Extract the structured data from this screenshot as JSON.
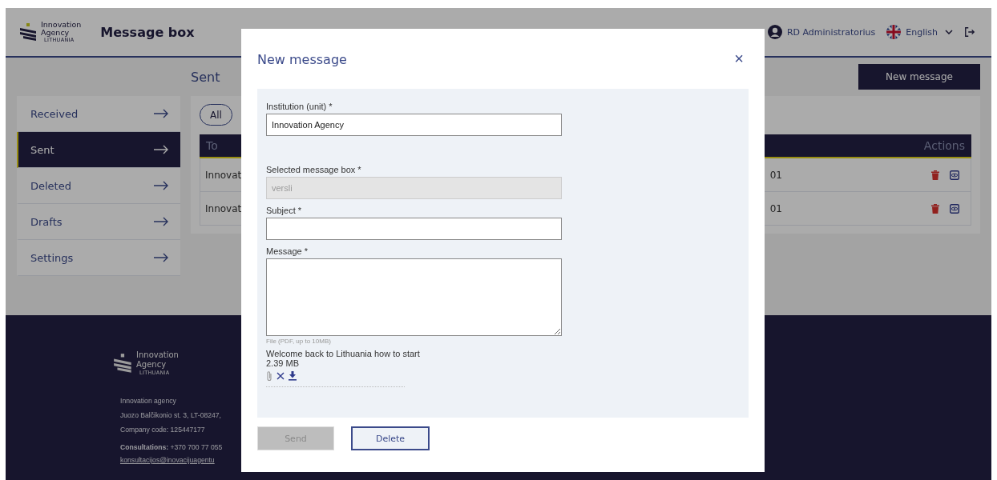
{
  "header": {
    "logo": {
      "line_1": "Innovation",
      "line_2": "Agency",
      "line_3": "LITHUANIA"
    },
    "title": "Message box",
    "user": "RD Administratorius",
    "language": "English"
  },
  "sidebar": {
    "items": [
      {
        "label": "Received",
        "selected": false
      },
      {
        "label": "Sent",
        "selected": true
      },
      {
        "label": "Deleted",
        "selected": false
      },
      {
        "label": "Drafts",
        "selected": false
      },
      {
        "label": "Settings",
        "selected": false
      }
    ]
  },
  "page_heading": "Sent",
  "new_message_button": "New message",
  "filters": [
    {
      "label": "All"
    }
  ],
  "table": {
    "columns": [
      "To",
      "Actions"
    ],
    "rows": [
      {
        "to": "Innovat",
        "column_2": "01"
      },
      {
        "to": "Innovat",
        "column_2": "01"
      }
    ]
  },
  "footer": {
    "logo": {
      "line_1": "Innovation",
      "line_2": "Agency",
      "line_3": "LITHUANIA"
    },
    "lines": [
      "Innovation agency",
      "Juozo Balčikonio st. 3, LT-08247,",
      "Company code: 125447177"
    ],
    "consultations_label": "Consultations:",
    "phone": "+370 700 77 055",
    "email": "konsultacijos@inovacijuagentu"
  },
  "modal": {
    "title": "New message",
    "close": "×",
    "fields": [
      {
        "kind": "input",
        "label": "Institution (unit) *",
        "value": "Innovation Agency",
        "disabled": false
      },
      {
        "kind": "input",
        "label": "Selected message box *",
        "value": "versli",
        "disabled": true
      },
      {
        "kind": "input",
        "label": "Subject *",
        "disabled": false
      },
      {
        "kind": "textarea",
        "label": "Message *",
        "disabled": false
      }
    ],
    "file_hint": "File (PDF, up to 10MB)",
    "attachment": {
      "name": "Welcome back to Lithuania how to start",
      "size": "2.39 MB"
    },
    "buttons": [
      {
        "label": "Send",
        "disabled": true
      },
      {
        "label": "Delete",
        "disabled": false
      }
    ]
  }
}
